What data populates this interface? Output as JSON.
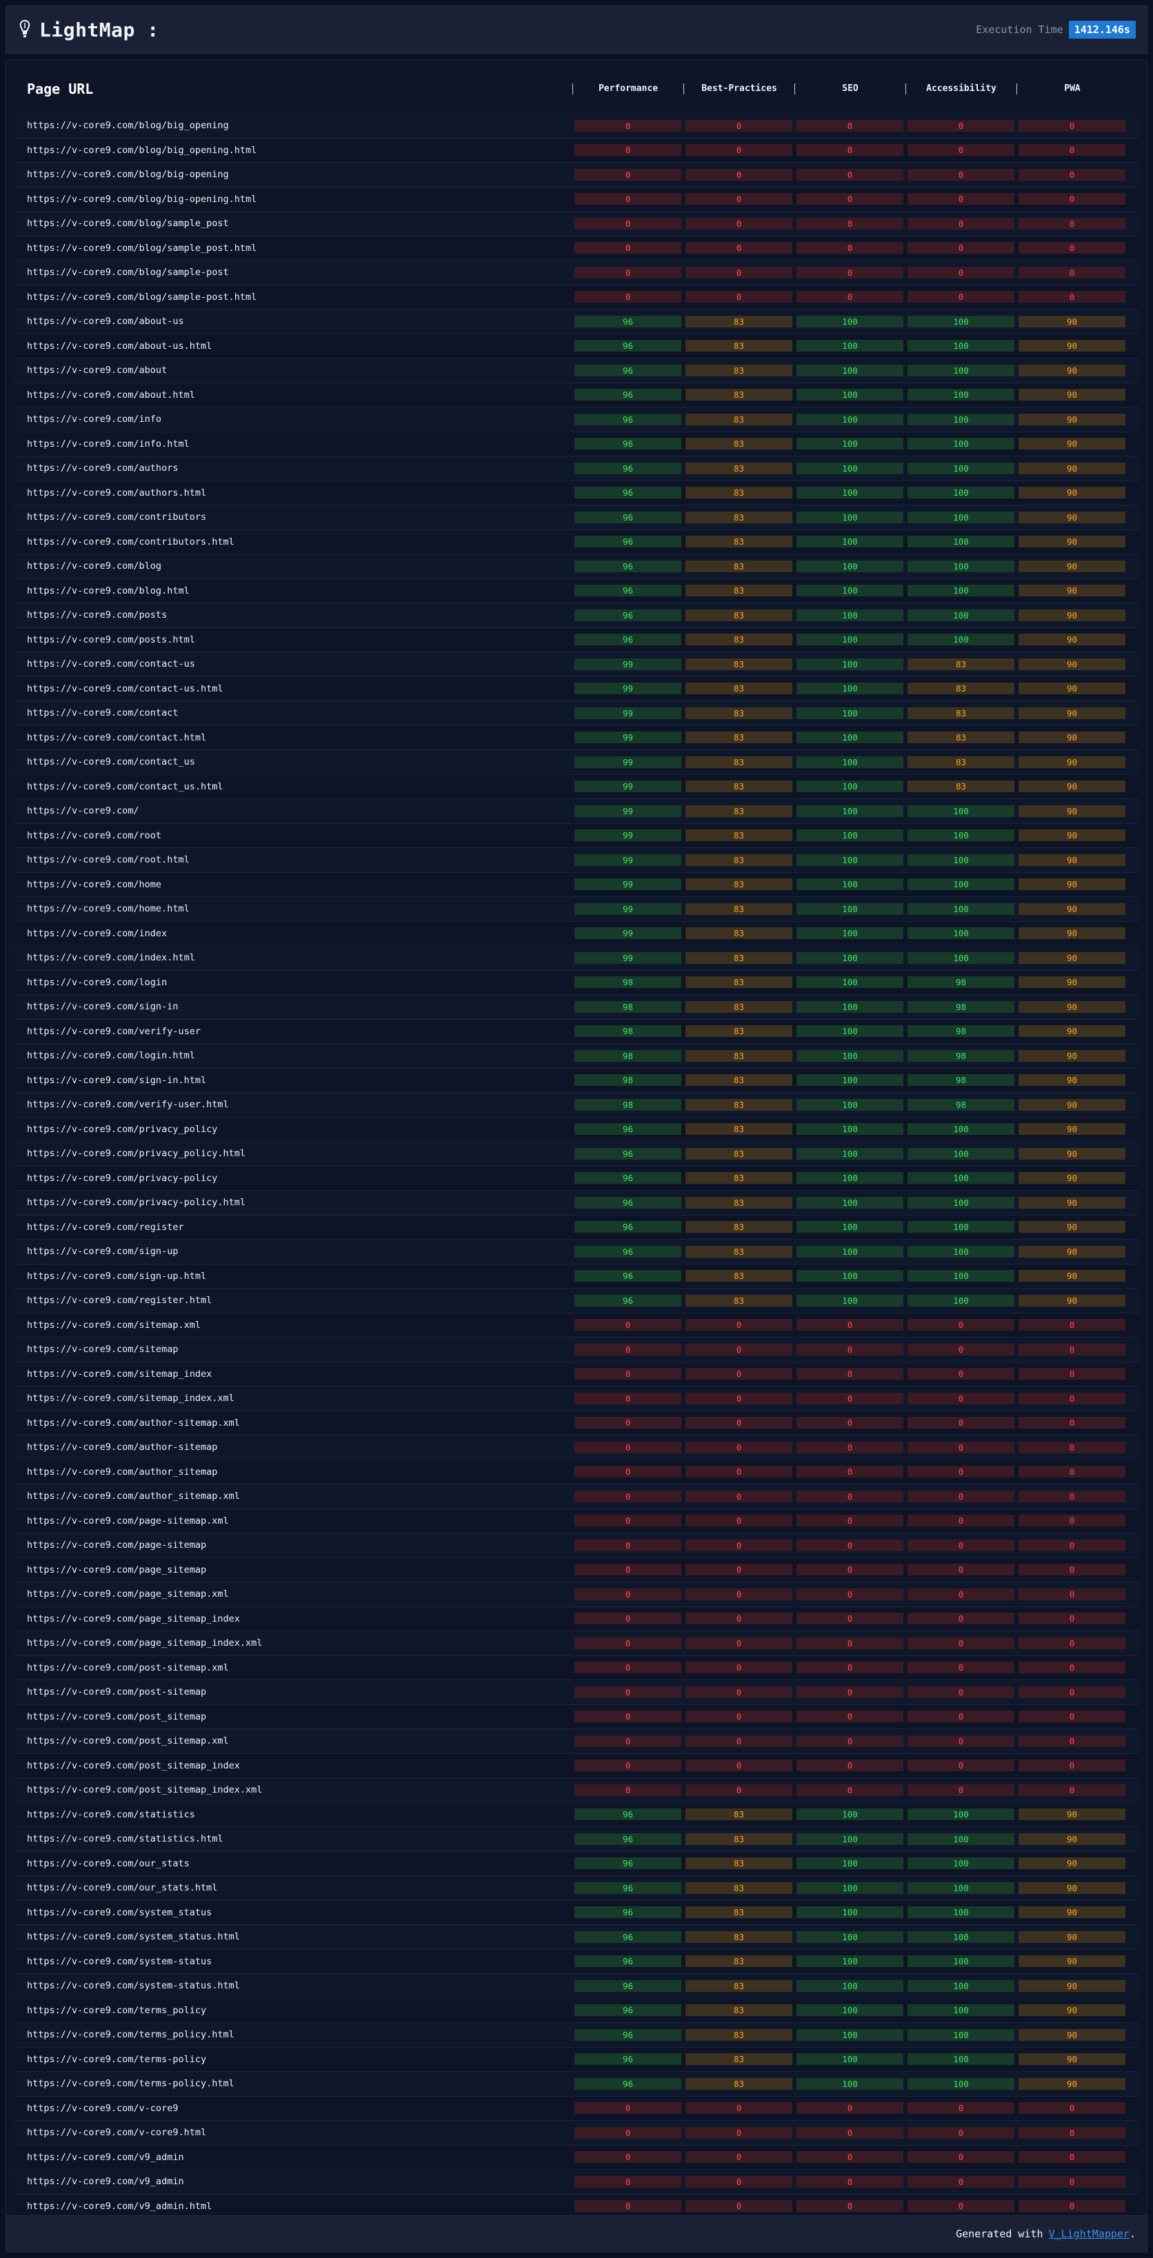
{
  "header": {
    "title": "LightMap :",
    "execution_label": "Execution Time",
    "execution_value": "1412.146s"
  },
  "table": {
    "columns": [
      "Page URL",
      "Performance",
      "Best-Practices",
      "SEO",
      "Accessibility",
      "PWA"
    ],
    "rows": [
      [
        "https://v-core9.com/blog/big_opening",
        0,
        0,
        0,
        0,
        0
      ],
      [
        "https://v-core9.com/blog/big_opening.html",
        0,
        0,
        0,
        0,
        0
      ],
      [
        "https://v-core9.com/blog/big-opening",
        0,
        0,
        0,
        0,
        0
      ],
      [
        "https://v-core9.com/blog/big-opening.html",
        0,
        0,
        0,
        0,
        0
      ],
      [
        "https://v-core9.com/blog/sample_post",
        0,
        0,
        0,
        0,
        0
      ],
      [
        "https://v-core9.com/blog/sample_post.html",
        0,
        0,
        0,
        0,
        0
      ],
      [
        "https://v-core9.com/blog/sample-post",
        0,
        0,
        0,
        0,
        0
      ],
      [
        "https://v-core9.com/blog/sample-post.html",
        0,
        0,
        0,
        0,
        0
      ],
      [
        "https://v-core9.com/about-us",
        96,
        83,
        100,
        100,
        90
      ],
      [
        "https://v-core9.com/about-us.html",
        96,
        83,
        100,
        100,
        90
      ],
      [
        "https://v-core9.com/about",
        96,
        83,
        100,
        100,
        90
      ],
      [
        "https://v-core9.com/about.html",
        96,
        83,
        100,
        100,
        90
      ],
      [
        "https://v-core9.com/info",
        96,
        83,
        100,
        100,
        90
      ],
      [
        "https://v-core9.com/info.html",
        96,
        83,
        100,
        100,
        90
      ],
      [
        "https://v-core9.com/authors",
        96,
        83,
        100,
        100,
        90
      ],
      [
        "https://v-core9.com/authors.html",
        96,
        83,
        100,
        100,
        90
      ],
      [
        "https://v-core9.com/contributors",
        96,
        83,
        100,
        100,
        90
      ],
      [
        "https://v-core9.com/contributors.html",
        96,
        83,
        100,
        100,
        90
      ],
      [
        "https://v-core9.com/blog",
        96,
        83,
        100,
        100,
        90
      ],
      [
        "https://v-core9.com/blog.html",
        96,
        83,
        100,
        100,
        90
      ],
      [
        "https://v-core9.com/posts",
        96,
        83,
        100,
        100,
        90
      ],
      [
        "https://v-core9.com/posts.html",
        96,
        83,
        100,
        100,
        90
      ],
      [
        "https://v-core9.com/contact-us",
        99,
        83,
        100,
        83,
        90
      ],
      [
        "https://v-core9.com/contact-us.html",
        99,
        83,
        100,
        83,
        90
      ],
      [
        "https://v-core9.com/contact",
        99,
        83,
        100,
        83,
        90
      ],
      [
        "https://v-core9.com/contact.html",
        99,
        83,
        100,
        83,
        90
      ],
      [
        "https://v-core9.com/contact_us",
        99,
        83,
        100,
        83,
        90
      ],
      [
        "https://v-core9.com/contact_us.html",
        99,
        83,
        100,
        83,
        90
      ],
      [
        "https://v-core9.com/",
        99,
        83,
        100,
        100,
        90
      ],
      [
        "https://v-core9.com/root",
        99,
        83,
        100,
        100,
        90
      ],
      [
        "https://v-core9.com/root.html",
        99,
        83,
        100,
        100,
        90
      ],
      [
        "https://v-core9.com/home",
        99,
        83,
        100,
        100,
        90
      ],
      [
        "https://v-core9.com/home.html",
        99,
        83,
        100,
        100,
        90
      ],
      [
        "https://v-core9.com/index",
        99,
        83,
        100,
        100,
        90
      ],
      [
        "https://v-core9.com/index.html",
        99,
        83,
        100,
        100,
        90
      ],
      [
        "https://v-core9.com/login",
        98,
        83,
        100,
        98,
        90
      ],
      [
        "https://v-core9.com/sign-in",
        98,
        83,
        100,
        98,
        90
      ],
      [
        "https://v-core9.com/verify-user",
        98,
        83,
        100,
        98,
        90
      ],
      [
        "https://v-core9.com/login.html",
        98,
        83,
        100,
        98,
        90
      ],
      [
        "https://v-core9.com/sign-in.html",
        98,
        83,
        100,
        98,
        90
      ],
      [
        "https://v-core9.com/verify-user.html",
        98,
        83,
        100,
        98,
        90
      ],
      [
        "https://v-core9.com/privacy_policy",
        96,
        83,
        100,
        100,
        90
      ],
      [
        "https://v-core9.com/privacy_policy.html",
        96,
        83,
        100,
        100,
        90
      ],
      [
        "https://v-core9.com/privacy-policy",
        96,
        83,
        100,
        100,
        90
      ],
      [
        "https://v-core9.com/privacy-policy.html",
        96,
        83,
        100,
        100,
        90
      ],
      [
        "https://v-core9.com/register",
        96,
        83,
        100,
        100,
        90
      ],
      [
        "https://v-core9.com/sign-up",
        96,
        83,
        100,
        100,
        90
      ],
      [
        "https://v-core9.com/sign-up.html",
        96,
        83,
        100,
        100,
        90
      ],
      [
        "https://v-core9.com/register.html",
        96,
        83,
        100,
        100,
        90
      ],
      [
        "https://v-core9.com/sitemap.xml",
        0,
        0,
        0,
        0,
        0
      ],
      [
        "https://v-core9.com/sitemap",
        0,
        0,
        0,
        0,
        0
      ],
      [
        "https://v-core9.com/sitemap_index",
        0,
        0,
        0,
        0,
        0
      ],
      [
        "https://v-core9.com/sitemap_index.xml",
        0,
        0,
        0,
        0,
        0
      ],
      [
        "https://v-core9.com/author-sitemap.xml",
        0,
        0,
        0,
        0,
        0
      ],
      [
        "https://v-core9.com/author-sitemap",
        0,
        0,
        0,
        0,
        0
      ],
      [
        "https://v-core9.com/author_sitemap",
        0,
        0,
        0,
        0,
        0
      ],
      [
        "https://v-core9.com/author_sitemap.xml",
        0,
        0,
        0,
        0,
        0
      ],
      [
        "https://v-core9.com/page-sitemap.xml",
        0,
        0,
        0,
        0,
        0
      ],
      [
        "https://v-core9.com/page-sitemap",
        0,
        0,
        0,
        0,
        0
      ],
      [
        "https://v-core9.com/page_sitemap",
        0,
        0,
        0,
        0,
        0
      ],
      [
        "https://v-core9.com/page_sitemap.xml",
        0,
        0,
        0,
        0,
        0
      ],
      [
        "https://v-core9.com/page_sitemap_index",
        0,
        0,
        0,
        0,
        0
      ],
      [
        "https://v-core9.com/page_sitemap_index.xml",
        0,
        0,
        0,
        0,
        0
      ],
      [
        "https://v-core9.com/post-sitemap.xml",
        0,
        0,
        0,
        0,
        0
      ],
      [
        "https://v-core9.com/post-sitemap",
        0,
        0,
        0,
        0,
        0
      ],
      [
        "https://v-core9.com/post_sitemap",
        0,
        0,
        0,
        0,
        0
      ],
      [
        "https://v-core9.com/post_sitemap.xml",
        0,
        0,
        0,
        0,
        0
      ],
      [
        "https://v-core9.com/post_sitemap_index",
        0,
        0,
        0,
        0,
        0
      ],
      [
        "https://v-core9.com/post_sitemap_index.xml",
        0,
        0,
        0,
        0,
        0
      ],
      [
        "https://v-core9.com/statistics",
        96,
        83,
        100,
        100,
        90
      ],
      [
        "https://v-core9.com/statistics.html",
        96,
        83,
        100,
        100,
        90
      ],
      [
        "https://v-core9.com/our_stats",
        96,
        83,
        100,
        100,
        90
      ],
      [
        "https://v-core9.com/our_stats.html",
        96,
        83,
        100,
        100,
        90
      ],
      [
        "https://v-core9.com/system_status",
        96,
        83,
        100,
        100,
        90
      ],
      [
        "https://v-core9.com/system_status.html",
        96,
        83,
        100,
        100,
        90
      ],
      [
        "https://v-core9.com/system-status",
        96,
        83,
        100,
        100,
        90
      ],
      [
        "https://v-core9.com/system-status.html",
        96,
        83,
        100,
        100,
        90
      ],
      [
        "https://v-core9.com/terms_policy",
        96,
        83,
        100,
        100,
        90
      ],
      [
        "https://v-core9.com/terms_policy.html",
        96,
        83,
        100,
        100,
        90
      ],
      [
        "https://v-core9.com/terms-policy",
        96,
        83,
        100,
        100,
        90
      ],
      [
        "https://v-core9.com/terms-policy.html",
        96,
        83,
        100,
        100,
        90
      ],
      [
        "https://v-core9.com/v-core9",
        0,
        0,
        0,
        0,
        0
      ],
      [
        "https://v-core9.com/v-core9.html",
        0,
        0,
        0,
        0,
        0
      ],
      [
        "https://v-core9.com/v9_admin",
        0,
        0,
        0,
        0,
        0
      ],
      [
        "https://v-core9.com/v9_admin",
        0,
        0,
        0,
        0,
        0
      ],
      [
        "https://v-core9.com/v9_admin.html",
        0,
        0,
        0,
        0,
        0
      ]
    ]
  },
  "colors": {
    "red": "#ff4a4a",
    "green": "#3fe26a",
    "orange": "#f5a524",
    "accent": "#1f7ad6"
  },
  "footer": {
    "text": "Generated with",
    "link_label": "V_LightMapper",
    "suffix": "."
  }
}
